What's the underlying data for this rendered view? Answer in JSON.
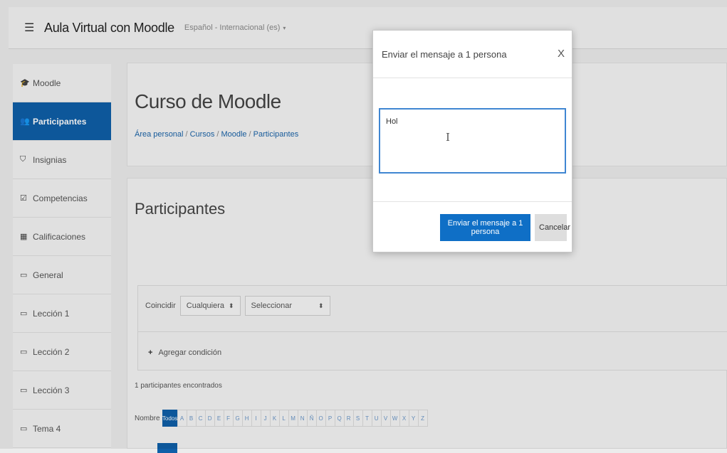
{
  "navbar": {
    "menu_icon": "hamburger-icon",
    "site_name": "Aula Virtual con Moodle",
    "language": "Español - Internacional (es)",
    "language_caret": "▾"
  },
  "sidebar": {
    "items": [
      {
        "label": "Moodle",
        "icon": "graduation-cap-icon",
        "glyph": "🎓"
      },
      {
        "label": "Participantes",
        "icon": "users-icon",
        "glyph": "👥"
      },
      {
        "label": "Insignias",
        "icon": "shield-icon",
        "glyph": "⛉"
      },
      {
        "label": "Competencias",
        "icon": "checkbox-icon",
        "glyph": "☑"
      },
      {
        "label": "Calificaciones",
        "icon": "table-icon",
        "glyph": "▦"
      },
      {
        "label": "General",
        "icon": "folder-icon",
        "glyph": "▭"
      },
      {
        "label": "Lección 1",
        "icon": "folder-icon",
        "glyph": "▭"
      },
      {
        "label": "Lección 2",
        "icon": "folder-icon",
        "glyph": "▭"
      },
      {
        "label": "Lección 3",
        "icon": "folder-icon",
        "glyph": "▭"
      },
      {
        "label": "Tema 4",
        "icon": "folder-icon",
        "glyph": "▭"
      }
    ]
  },
  "header": {
    "title": "Curso de Moodle",
    "breadcrumb": [
      "Área personal",
      "Cursos",
      "Moodle",
      "Participantes"
    ],
    "separator": "/"
  },
  "main": {
    "section_title": "Participantes",
    "filter": {
      "match_label": "Coincidir",
      "match_value": "Cualquiera",
      "select_value": "Seleccionar",
      "arrow": "⬍",
      "add_condition": "Agregar condición",
      "plus": "+"
    },
    "count_text": "1 participantes encontrados",
    "name_label": "Nombre",
    "letters": [
      "Todos",
      "A",
      "B",
      "C",
      "D",
      "E",
      "F",
      "G",
      "H",
      "I",
      "J",
      "K",
      "L",
      "M",
      "N",
      "Ñ",
      "O",
      "P",
      "Q",
      "R",
      "S",
      "T",
      "U",
      "V",
      "W",
      "X",
      "Y",
      "Z"
    ]
  },
  "modal": {
    "title": "Enviar el mensaje a 1 persona",
    "close": "X",
    "message_text": "Hol",
    "cursor_glyph": "I",
    "send_button": "Enviar el mensaje a 1 persona",
    "cancel_button": "Cancelar"
  },
  "colors": {
    "primary": "#0f6fc6",
    "sidebar_active": "#0f5fa8",
    "textarea_focus": "#3f86d2"
  }
}
